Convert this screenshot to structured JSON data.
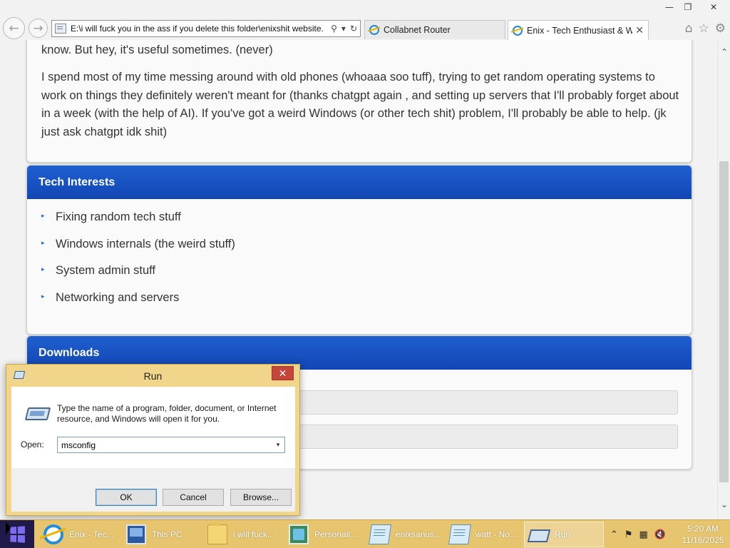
{
  "browser": {
    "window_controls": {
      "minimize": "—",
      "restore": "❐",
      "close": "✕"
    },
    "back_icon": "back-arrow-icon",
    "forward_icon": "forward-arrow-icon",
    "address": "E:\\i will fuck you in the ass if you delete this folder\\enixshit website.",
    "search_glyph": "⚲",
    "dropdown_glyph": "▾",
    "refresh_glyph": "↻",
    "tabs": [
      {
        "title": "Collabnet Router",
        "active": false
      },
      {
        "title": "Enix - Tech Enthusiast & Wi...",
        "active": true,
        "close": "✕"
      }
    ],
    "home_glyph": "⌂",
    "favorites_glyph": "☆",
    "tools_glyph": "⚙"
  },
  "page": {
    "about_p1": "know. But hey, it's useful sometimes. (never)",
    "about_p2": "I spend most of my time messing around with old phones (whoaaa soo tuff), trying to get random operating systems to work on things they definitely weren't meant for (thanks chatgpt again , and setting up servers that I'll probably forget about in a week (with the help of AI). If you've got a weird Windows (or other tech shit) problem, I'll probably be able to help. (jk just ask chatgpt idk shit)",
    "interests_title": "Tech Interests",
    "interests": [
      "Fixing random tech stuff",
      "Windows internals (the weird stuff)",
      "System admin stuff",
      "Networking and servers"
    ],
    "bullet_glyph": "▸",
    "downloads_title": "Downloads"
  },
  "scrollbar": {
    "up": "⌃",
    "down": "⌄"
  },
  "run_dialog": {
    "title": "Run",
    "close": "✕",
    "instructions": "Type the name of a program, folder, document, or Internet resource, and Windows will open it for you.",
    "open_label": "Open:",
    "open_value": "msconfig",
    "dropdown_glyph": "▾",
    "ok": "OK",
    "cancel": "Cancel",
    "browse": "Browse..."
  },
  "taskbar": {
    "items": [
      {
        "label": "Enix - Tec...",
        "icon": "internet-explorer-icon"
      },
      {
        "label": "This PC",
        "icon": "this-pc-icon"
      },
      {
        "label": "i will fuck...",
        "icon": "folder-icon"
      },
      {
        "label": "Personali...",
        "icon": "personalization-icon"
      },
      {
        "label": "enixsanus...",
        "icon": "notepad-icon"
      },
      {
        "label": "watt - No...",
        "icon": "notepad-icon"
      },
      {
        "label": "Run",
        "icon": "run-icon"
      }
    ],
    "tray": {
      "chevron": "⌃",
      "flag": "⚑",
      "network": "▦",
      "volume": "🔇"
    },
    "time": "5:20 AM",
    "date": "11/16/2025"
  },
  "colors": {
    "card_header": "#1a55c8",
    "taskbar": "#e7c46e",
    "run_frame": "#f0d58a",
    "start_button": "#201a4a"
  }
}
